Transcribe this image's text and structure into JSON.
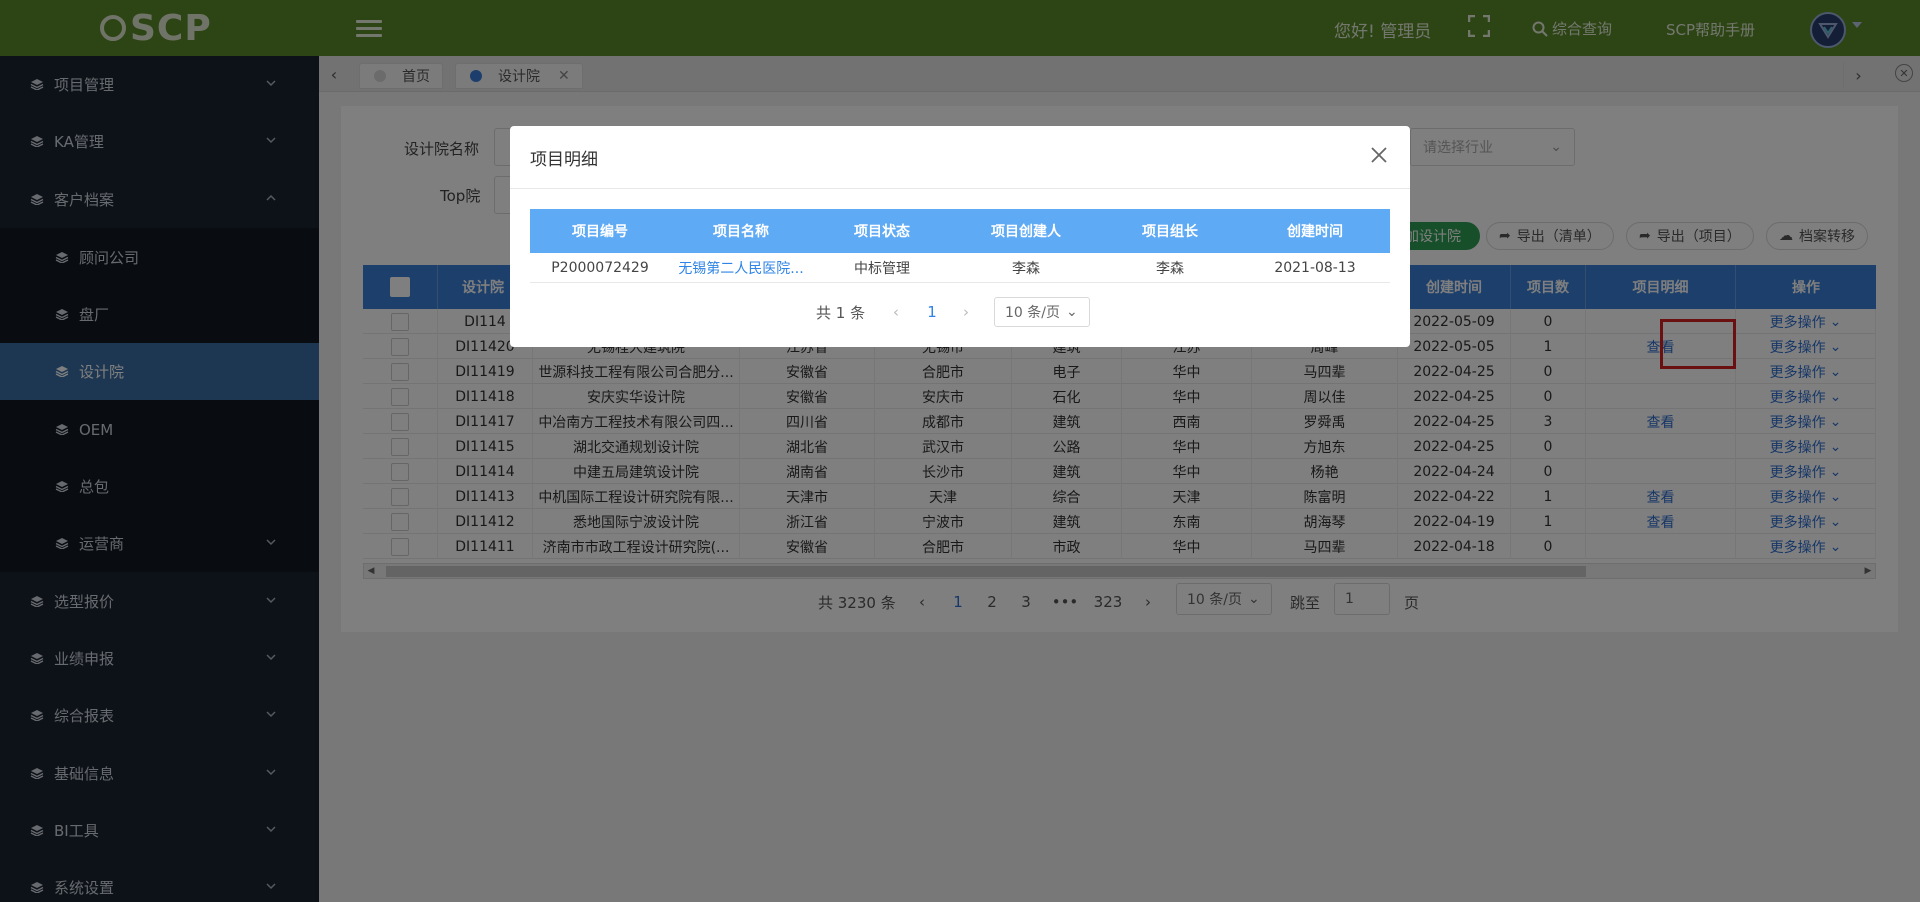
{
  "header": {
    "logo_text": "SCP",
    "greeting": "您好! 管理员",
    "search_link": "综合查询",
    "help_link": "SCP帮助手册"
  },
  "sidebar": {
    "items": [
      {
        "label": "项目管理",
        "icon": "layers-icon"
      },
      {
        "label": "KA管理",
        "icon": "layers-icon"
      },
      {
        "label": "客户档案",
        "icon": "layers-icon"
      },
      {
        "label": "顾问公司",
        "icon": "layers-icon"
      },
      {
        "label": "盘厂",
        "icon": "layers-icon"
      },
      {
        "label": "设计院",
        "icon": "layers-icon"
      },
      {
        "label": "OEM",
        "icon": "layers-icon"
      },
      {
        "label": "总包",
        "icon": "layers-icon"
      },
      {
        "label": "运营商",
        "icon": "layers-icon"
      },
      {
        "label": "选型报价",
        "icon": "layers-icon"
      },
      {
        "label": "业绩申报",
        "icon": "layers-icon"
      },
      {
        "label": "综合报表",
        "icon": "layers-icon"
      },
      {
        "label": "基础信息",
        "icon": "layers-icon"
      },
      {
        "label": "BI工具",
        "icon": "layers-icon"
      },
      {
        "label": "系统设置",
        "icon": "layers-icon"
      }
    ]
  },
  "tabs": [
    {
      "label": "首页"
    },
    {
      "label": "设计院"
    }
  ],
  "filters": {
    "name_label": "设计院名称",
    "top_label": "Top院",
    "industry_placeholder": "请选择行业"
  },
  "actions": {
    "add": "加设计院",
    "export_list": "导出（清单）",
    "export_project": "导出（项目）",
    "transfer": "档案转移"
  },
  "table": {
    "headers": [
      "设计院",
      "创建时间",
      "项目数",
      "项目明细",
      "操作"
    ],
    "rows": [
      {
        "id": "DI114",
        "name": "",
        "province": "",
        "city": "",
        "industry": "",
        "region": "",
        "owner": "",
        "date": "2022-05-09",
        "count": "0",
        "detail": "",
        "op": "更多操作"
      },
      {
        "id": "DI11420",
        "name": "无锡程大建筑院",
        "province": "江苏省",
        "city": "无锡市",
        "industry": "建筑",
        "region": "江苏",
        "owner": "周峰",
        "date": "2022-05-05",
        "count": "1",
        "detail": "查看",
        "op": "更多操作"
      },
      {
        "id": "DI11419",
        "name": "世源科技工程有限公司合肥分...",
        "province": "安徽省",
        "city": "合肥市",
        "industry": "电子",
        "region": "华中",
        "owner": "马四辈",
        "date": "2022-04-25",
        "count": "0",
        "detail": "",
        "op": "更多操作"
      },
      {
        "id": "DI11418",
        "name": "安庆实华设计院",
        "province": "安徽省",
        "city": "安庆市",
        "industry": "石化",
        "region": "华中",
        "owner": "周以佳",
        "date": "2022-04-25",
        "count": "0",
        "detail": "",
        "op": "更多操作"
      },
      {
        "id": "DI11417",
        "name": "中冶南方工程技术有限公司四...",
        "province": "四川省",
        "city": "成都市",
        "industry": "建筑",
        "region": "西南",
        "owner": "罗舜禹",
        "date": "2022-04-25",
        "count": "3",
        "detail": "查看",
        "op": "更多操作"
      },
      {
        "id": "DI11415",
        "name": "湖北交通规划设计院",
        "province": "湖北省",
        "city": "武汉市",
        "industry": "公路",
        "region": "华中",
        "owner": "方旭东",
        "date": "2022-04-25",
        "count": "0",
        "detail": "",
        "op": "更多操作"
      },
      {
        "id": "DI11414",
        "name": "中建五局建筑设计院",
        "province": "湖南省",
        "city": "长沙市",
        "industry": "建筑",
        "region": "华中",
        "owner": "杨艳",
        "date": "2022-04-24",
        "count": "0",
        "detail": "",
        "op": "更多操作"
      },
      {
        "id": "DI11413",
        "name": "中机国际工程设计研究院有限...",
        "province": "天津市",
        "city": "天津",
        "industry": "综合",
        "region": "天津",
        "owner": "陈富明",
        "date": "2022-04-22",
        "count": "1",
        "detail": "查看",
        "op": "更多操作"
      },
      {
        "id": "DI11412",
        "name": "悉地国际宁波设计院",
        "province": "浙江省",
        "city": "宁波市",
        "industry": "建筑",
        "region": "东南",
        "owner": "胡海琴",
        "date": "2022-04-19",
        "count": "1",
        "detail": "查看",
        "op": "更多操作"
      },
      {
        "id": "DI11411",
        "name": "济南市市政工程设计研究院(...",
        "province": "安徽省",
        "city": "合肥市",
        "industry": "市政",
        "region": "华中",
        "owner": "马四辈",
        "date": "2022-04-18",
        "count": "0",
        "detail": "",
        "op": "更多操作"
      }
    ]
  },
  "pagination": {
    "total": "共 3230 条",
    "pages": [
      "1",
      "2",
      "3",
      "•••",
      "323"
    ],
    "page_size": "10 条/页",
    "jump_label": "跳至",
    "jump_value": "1",
    "page_unit": "页"
  },
  "modal": {
    "title": "项目明细",
    "headers": [
      "项目编号",
      "项目名称",
      "项目状态",
      "项目创建人",
      "项目组长",
      "创建时间"
    ],
    "row": {
      "code": "P2000072429",
      "name": "无锡第二人民医院...",
      "status": "中标管理",
      "creator": "李森",
      "leader": "李森",
      "date": "2021-08-13"
    },
    "total": "共 1 条",
    "page": "1",
    "page_size": "10 条/页"
  },
  "colors": {
    "header_bg": "#5a8a2a",
    "sidebar_bg": "#1a2430",
    "sidebar_active": "#3a6ea5",
    "table_header": "#3a7fd8",
    "modal_table_header": "#5faaf5",
    "link": "#2f6fd0",
    "highlight_box": "#d42020"
  }
}
